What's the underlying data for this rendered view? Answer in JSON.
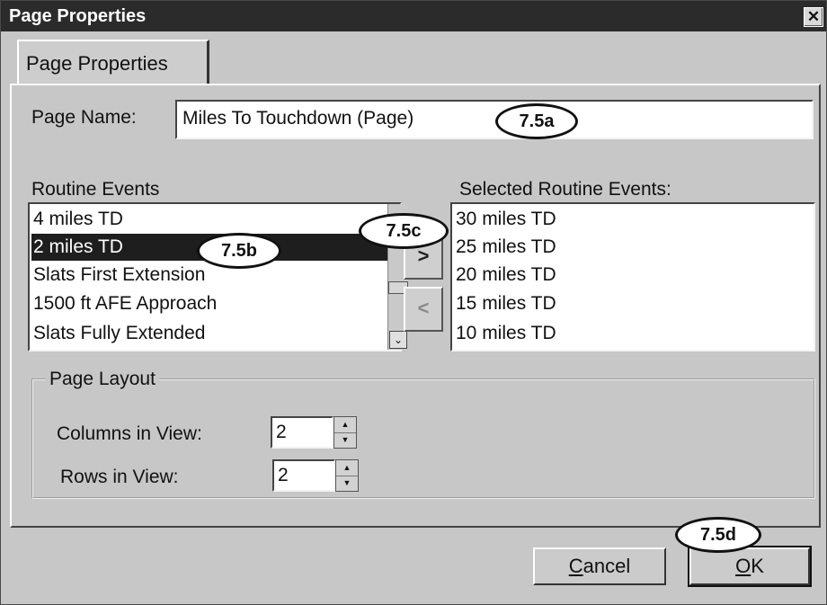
{
  "window": {
    "title": "Page Properties",
    "close_label": "✕"
  },
  "tab": {
    "label": "Page Properties"
  },
  "page_name": {
    "label": "Page Name:",
    "value": "Miles To Touchdown (Page)"
  },
  "routine_events": {
    "label": "Routine Events",
    "items": [
      "4 miles TD",
      "2 miles TD",
      "Slats First Extension",
      "1500 ft AFE Approach",
      "Slats Fully Extended"
    ],
    "selected_index": 1,
    "scroll_down_icon": "⌄"
  },
  "move_buttons": {
    "add_label": ">",
    "remove_label": "<"
  },
  "selected_routine_events": {
    "label": "Selected Routine Events:",
    "items": [
      "30 miles TD",
      "25 miles TD",
      "20 miles TD",
      "15 miles TD",
      "10 miles TD"
    ]
  },
  "page_layout": {
    "legend": "Page Layout",
    "columns_label": "Columns in View:",
    "columns_value": "2",
    "rows_label": "Rows in View:",
    "rows_value": "2",
    "spin_up_icon": "▲",
    "spin_down_icon": "▼"
  },
  "buttons": {
    "cancel": "Cancel",
    "ok": "OK"
  },
  "callouts": {
    "a": "7.5a",
    "b": "7.5b",
    "c": "7.5c",
    "d": "7.5d"
  }
}
